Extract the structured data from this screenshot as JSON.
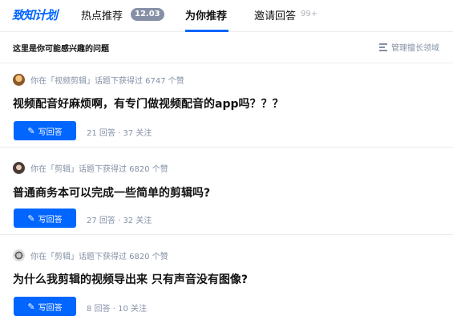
{
  "nav": {
    "logo": "致知计划",
    "tab_hot": "热点推荐",
    "hot_badge": "12.03",
    "tab_recommend": "为你推荐",
    "tab_invite": "邀请回答",
    "invite_count": "99+"
  },
  "subheader": {
    "title": "这里是你可能感兴趣的问题",
    "manage_label": "管理擅长领域"
  },
  "colors": {
    "accent": "#0066ff",
    "muted": "#8590a6",
    "badge": "#8590a6"
  },
  "questions": [
    {
      "meta": "你在「视频剪辑」话题下获得过 6747 个赞",
      "title": "视频配音好麻烦啊，有专门做视频配音的app吗？？？",
      "button": "写回答",
      "stats": "21 回答 · 37 关注",
      "avatar_icon": "user-avatar-icon"
    },
    {
      "meta": "你在「剪辑」话题下获得过 6820 个赞",
      "title": "普通商务本可以完成一些简单的剪辑吗?",
      "button": "写回答",
      "stats": "27 回答 · 32 关注",
      "avatar_icon": "user-avatar-icon"
    },
    {
      "meta": "你在「剪辑」话题下获得过 6820 个赞",
      "title": "为什么我剪辑的视频导出来 只有声音没有图像?",
      "button": "写回答",
      "stats": "8 回答 · 10 关注",
      "avatar_icon": "user-avatar-icon"
    }
  ]
}
